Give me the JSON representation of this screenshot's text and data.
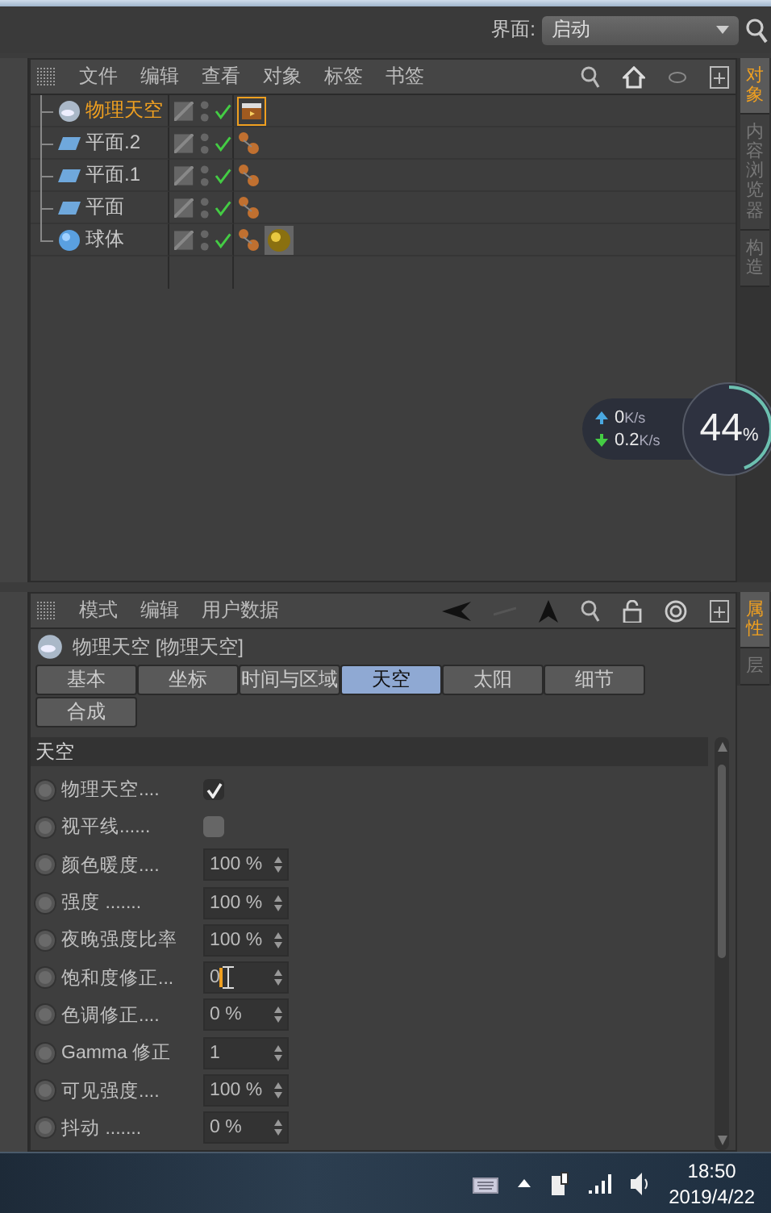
{
  "top_bar": {
    "layout_label": "界面:",
    "layout_value": "启动"
  },
  "object_manager": {
    "menu": [
      "文件",
      "编辑",
      "查看",
      "对象",
      "标签",
      "书签"
    ],
    "objects": [
      {
        "name": "物理天空",
        "selected": true,
        "kind": "sky",
        "tags": [
          {
            "kind": "clapper"
          }
        ]
      },
      {
        "name": "平面.2",
        "selected": false,
        "kind": "plane",
        "tags": [
          {
            "kind": "phong"
          }
        ]
      },
      {
        "name": "平面.1",
        "selected": false,
        "kind": "plane",
        "tags": [
          {
            "kind": "phong"
          }
        ]
      },
      {
        "name": "平面",
        "selected": false,
        "kind": "plane",
        "tags": [
          {
            "kind": "phong"
          }
        ]
      },
      {
        "name": "球体",
        "selected": false,
        "kind": "sphere",
        "tags": [
          {
            "kind": "phong"
          },
          {
            "kind": "material"
          }
        ]
      }
    ],
    "side_tabs": [
      {
        "label": "对象",
        "selected": true
      },
      {
        "label": "内容浏览器",
        "selected": false
      },
      {
        "label": "构造",
        "selected": false
      }
    ]
  },
  "network_widget": {
    "upload": "0",
    "upload_unit": "K/s",
    "download": "0.2",
    "download_unit": "K/s",
    "percent": "44",
    "percent_unit": "%",
    "level": 0.44
  },
  "attribute_manager": {
    "menu": [
      "模式",
      "编辑",
      "用户数据"
    ],
    "title": "物理天空 [物理天空]",
    "tabs": [
      {
        "label": "基本",
        "selected": false
      },
      {
        "label": "坐标",
        "selected": false
      },
      {
        "label": "时间与区域",
        "selected": false
      },
      {
        "label": "天空",
        "selected": true
      },
      {
        "label": "太阳",
        "selected": false
      },
      {
        "label": "细节",
        "selected": false
      },
      {
        "label": "合成",
        "selected": false
      }
    ],
    "section": "天空",
    "rows": [
      {
        "kind": "checkbox",
        "label": "物理天空....",
        "checked": true
      },
      {
        "kind": "checkbox",
        "label": "视平线......",
        "checked": false
      },
      {
        "kind": "number",
        "label": "颜色暖度....",
        "value": "100 %"
      },
      {
        "kind": "number",
        "label": "强度 .......",
        "value": "100 %"
      },
      {
        "kind": "number",
        "label": "夜晚强度比率",
        "value": "100 %"
      },
      {
        "kind": "editing",
        "label": "饱和度修正...",
        "value": "0"
      },
      {
        "kind": "number",
        "label": "色调修正....",
        "value": "0 %"
      },
      {
        "kind": "number",
        "label": "Gamma 修正",
        "value": "1"
      },
      {
        "kind": "number",
        "label": "可见强度....",
        "value": "100 %"
      },
      {
        "kind": "number",
        "label": "抖动 .......",
        "value": "0 %"
      }
    ],
    "side_tabs": [
      {
        "label": "属性",
        "selected": true
      },
      {
        "label": "层",
        "selected": false
      }
    ]
  },
  "taskbar": {
    "time": "18:50",
    "date": "2019/4/22"
  }
}
